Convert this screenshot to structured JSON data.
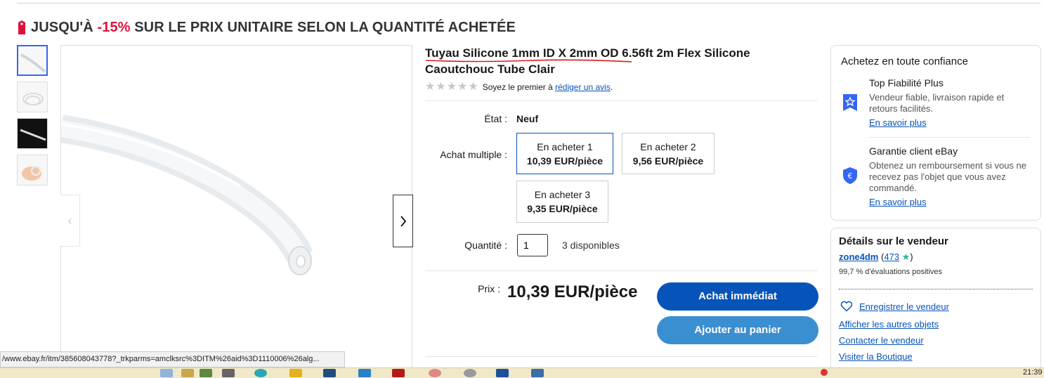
{
  "promo": {
    "prefix": "JUSQU'À ",
    "discount": "-15%",
    "suffix": " SUR LE PRIX UNITAIRE SELON LA QUANTITÉ ACHETÉE"
  },
  "product": {
    "title": "Tuyau Silicone 1mm ID X 2mm OD 6.56ft 2m Flex Silicone Caoutchouc Tube Clair",
    "rating_prefix": "Soyez le premier à ",
    "rating_link": "rédiger un avis",
    "rating_suffix": ".",
    "etat_label": "État :",
    "etat_value": "Neuf",
    "achat_multiple_label": "Achat multiple :",
    "quantity_options": [
      {
        "label": "En acheter 1",
        "price": "10,39 EUR/pièce"
      },
      {
        "label": "En acheter 2",
        "price": "9,56 EUR/pièce"
      },
      {
        "label": "En acheter 3",
        "price": "9,35 EUR/pièce"
      }
    ],
    "quantity_label": "Quantité :",
    "quantity_value": "1",
    "available": "3 disponibles",
    "price_label": "Prix :",
    "price": "10,39 EUR/pièce",
    "buy_now": "Achat immédiat",
    "add_to_cart": "Ajouter au panier"
  },
  "trust": {
    "title": "Achetez en toute confiance",
    "features": [
      {
        "title": "Top Fiabilité Plus",
        "desc": "Vendeur fiable, livraison rapide et retours facilités.",
        "link": "En savoir plus"
      },
      {
        "title": "Garantie client eBay",
        "desc": "Obtenez un remboursement si vous ne recevez pas l'objet que vous avez commandé.",
        "link": "En savoir plus"
      }
    ]
  },
  "seller": {
    "title": "Détails sur le vendeur",
    "name": "zone4dm",
    "feedback_count": "473",
    "positive": "99,7 % d'évaluations positives",
    "save": "Enregistrer le vendeur",
    "other_items": "Afficher les autres objets",
    "contact": "Contacter le vendeur",
    "store": "Visiter la Boutique"
  },
  "status_bar": {
    "url": "/www.ebay.fr/itm/385608043778?_trkparms=amclksrc%3DITM%26aid%3D1110006%26alg..."
  },
  "taskbar": {
    "clock": "21:39"
  },
  "colors": {
    "accent_red": "#e0103a",
    "link_blue": "#0654ba",
    "cart_blue": "#3a8fd0"
  }
}
